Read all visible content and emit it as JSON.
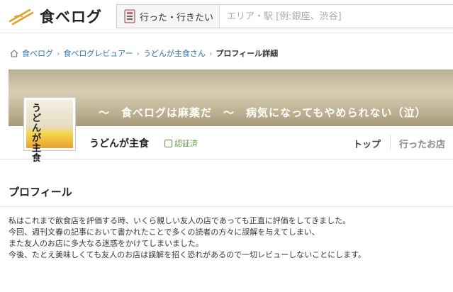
{
  "header": {
    "logo_text": "食べログ",
    "search": {
      "segment_label": "行った・行きたい",
      "area_placeholder": "エリア・駅 [例:銀座、渋谷]"
    }
  },
  "breadcrumb": {
    "items": [
      "食べログ",
      "食べログレビュアー",
      "うどんが主食さん"
    ],
    "current": "プロフィール詳細"
  },
  "cover": {
    "tagline": "～　食べログは麻薬だ　～　病気になってもやめられない（泣）"
  },
  "avatar": {
    "stamp_text": "うどんが主食"
  },
  "user": {
    "name": "うどんが主食",
    "verified_label": "認証済"
  },
  "nav": {
    "top_label": "トップ",
    "visited_label": "行ったお店"
  },
  "profile": {
    "section_title": "プロフィール",
    "lines": [
      "私はこれまで飲食店を評価する時、いくら親しい友人の店であっても正直に評価をしてきました。",
      "今回、週刊文春の記事において書かれたことで多くの読者の方々に誤解を与えてしまい、",
      "また友人のお店に多大なる迷惑をかけてしまいました。",
      "今後、たとえ美味しくても友人のお店は誤解を招く恐れがあるので一切レビューしないことにします。"
    ]
  },
  "colors": {
    "link": "#2b6fa8",
    "verified": "#5b9a3f"
  }
}
